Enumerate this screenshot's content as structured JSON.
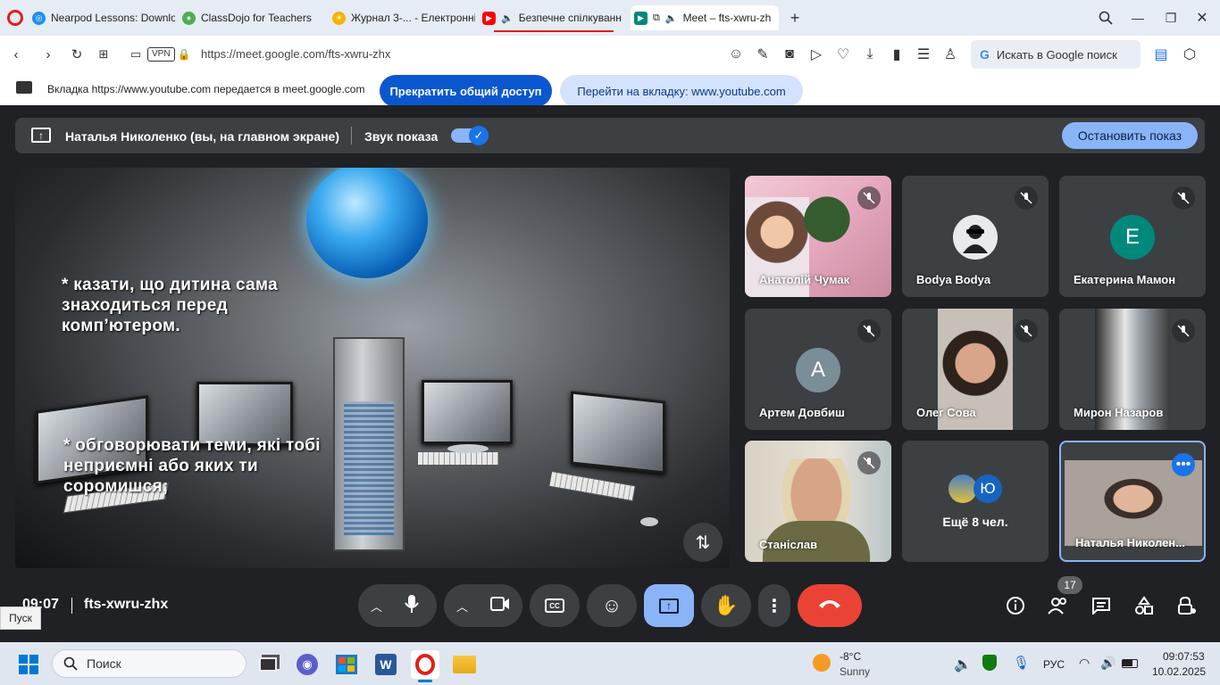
{
  "browser": {
    "tabs": [
      {
        "label": "Nearpod Lessons: Downlo",
        "icon": "nearpod-icon",
        "color": "#1f8ef1"
      },
      {
        "label": "ClassDojo for Teachers",
        "icon": "classdojo-icon",
        "color": "#4caf50"
      },
      {
        "label": "Журнал 3-... - Електронні",
        "icon": "sun-icon",
        "color": "#f6b300"
      },
      {
        "label": "Безпечне спілкуванн",
        "icon": "youtube-icon",
        "color": "#ff0000"
      },
      {
        "label": "Meet – fts-xwru-zh",
        "icon": "meet-icon",
        "color": "#00897b"
      }
    ],
    "url": "https://meet.google.com/fts-xwru-zhx",
    "vpn": "VPN",
    "search_placeholder": "Искать в Google поиск",
    "share_notice": "Вкладка https://www.youtube.com передается в meet.google.com",
    "stop_share_label": "Прекратить общий доступ",
    "goto_tab_label": "Перейти на вкладку: www.youtube.com"
  },
  "meet": {
    "presenter": "Наталья Николенко (вы, на главном экране)",
    "audio_label": "Звук показа",
    "stop_presenting": "Остановить показ",
    "slide_text_1": "* казати, що дитина сама знаходиться перед комп’ютером.",
    "slide_text_2": "* обговорювати теми, які тобі неприємні або яких ти соромишся;",
    "participants": [
      {
        "name": "Анатолій Чумак",
        "type": "video"
      },
      {
        "name": "Bodya Bodya",
        "type": "avatar"
      },
      {
        "name": "Екатерина Мамон",
        "type": "letter",
        "letter": "Е",
        "color": "#00897b"
      },
      {
        "name": "Артем Довбиш",
        "type": "letter",
        "letter": "А",
        "color": "#7a8e97"
      },
      {
        "name": "Олег Сова",
        "type": "video"
      },
      {
        "name": "Мирон Назаров",
        "type": "video"
      },
      {
        "name": "Станіслав",
        "type": "video"
      },
      {
        "name": "Ещё 8 чел.",
        "type": "more",
        "letter": "Ю"
      },
      {
        "name": "Наталья Николен...",
        "type": "self"
      }
    ],
    "time": "09:07",
    "meeting_code": "fts-xwru-zhx",
    "people_count": "17",
    "tooltip": "Пуск"
  },
  "taskbar": {
    "search_placeholder": "Поиск",
    "weather_temp": "-8°C",
    "weather_desc": "Sunny",
    "language": "РУС",
    "clock_time": "09:07:53",
    "clock_date": "10.02.2025"
  }
}
